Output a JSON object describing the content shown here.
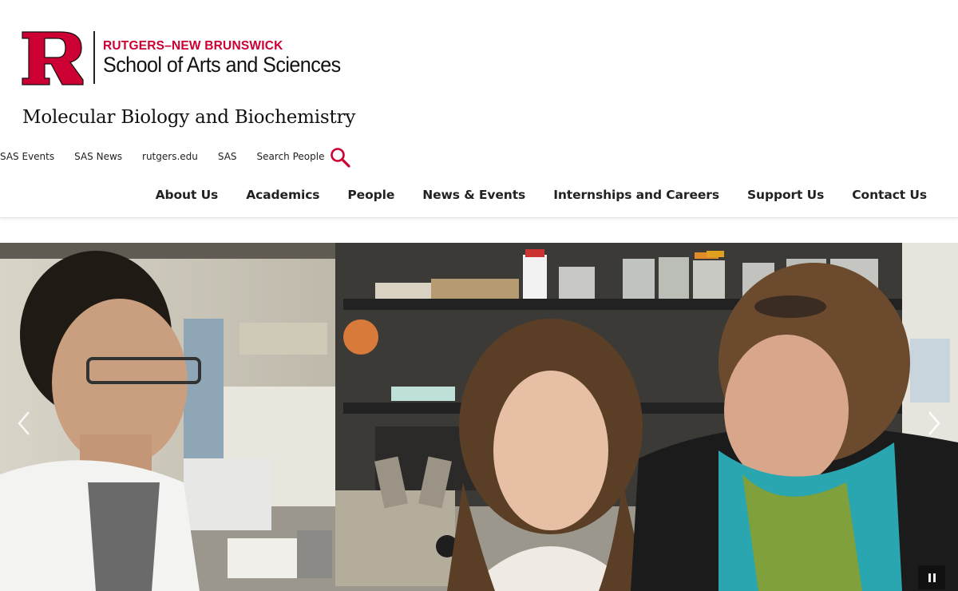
{
  "logo": {
    "top_line": "RUTGERS–NEW BRUNSWICK",
    "bottom_line": "School of Arts and Sciences",
    "mark_icon": "rutgers-r-logo",
    "brand_color": "#cc0033"
  },
  "department": {
    "title": "Molecular Biology and Biochemistry"
  },
  "utility_nav": {
    "items": [
      {
        "label": "SAS Events"
      },
      {
        "label": "SAS News"
      },
      {
        "label": "rutgers.edu"
      },
      {
        "label": "SAS"
      },
      {
        "label": "Search People"
      }
    ],
    "search_icon": "search-icon"
  },
  "main_nav": {
    "items": [
      {
        "label": "About Us"
      },
      {
        "label": "Academics"
      },
      {
        "label": "People"
      },
      {
        "label": "News & Events"
      },
      {
        "label": "Internships and Careers"
      },
      {
        "label": "Support Us"
      },
      {
        "label": "Contact Us"
      }
    ]
  },
  "hero": {
    "image": "lab-researchers-microscope-photo",
    "prev_icon": "chevron-left-icon",
    "next_icon": "chevron-right-icon",
    "pause_icon": "pause-icon"
  }
}
